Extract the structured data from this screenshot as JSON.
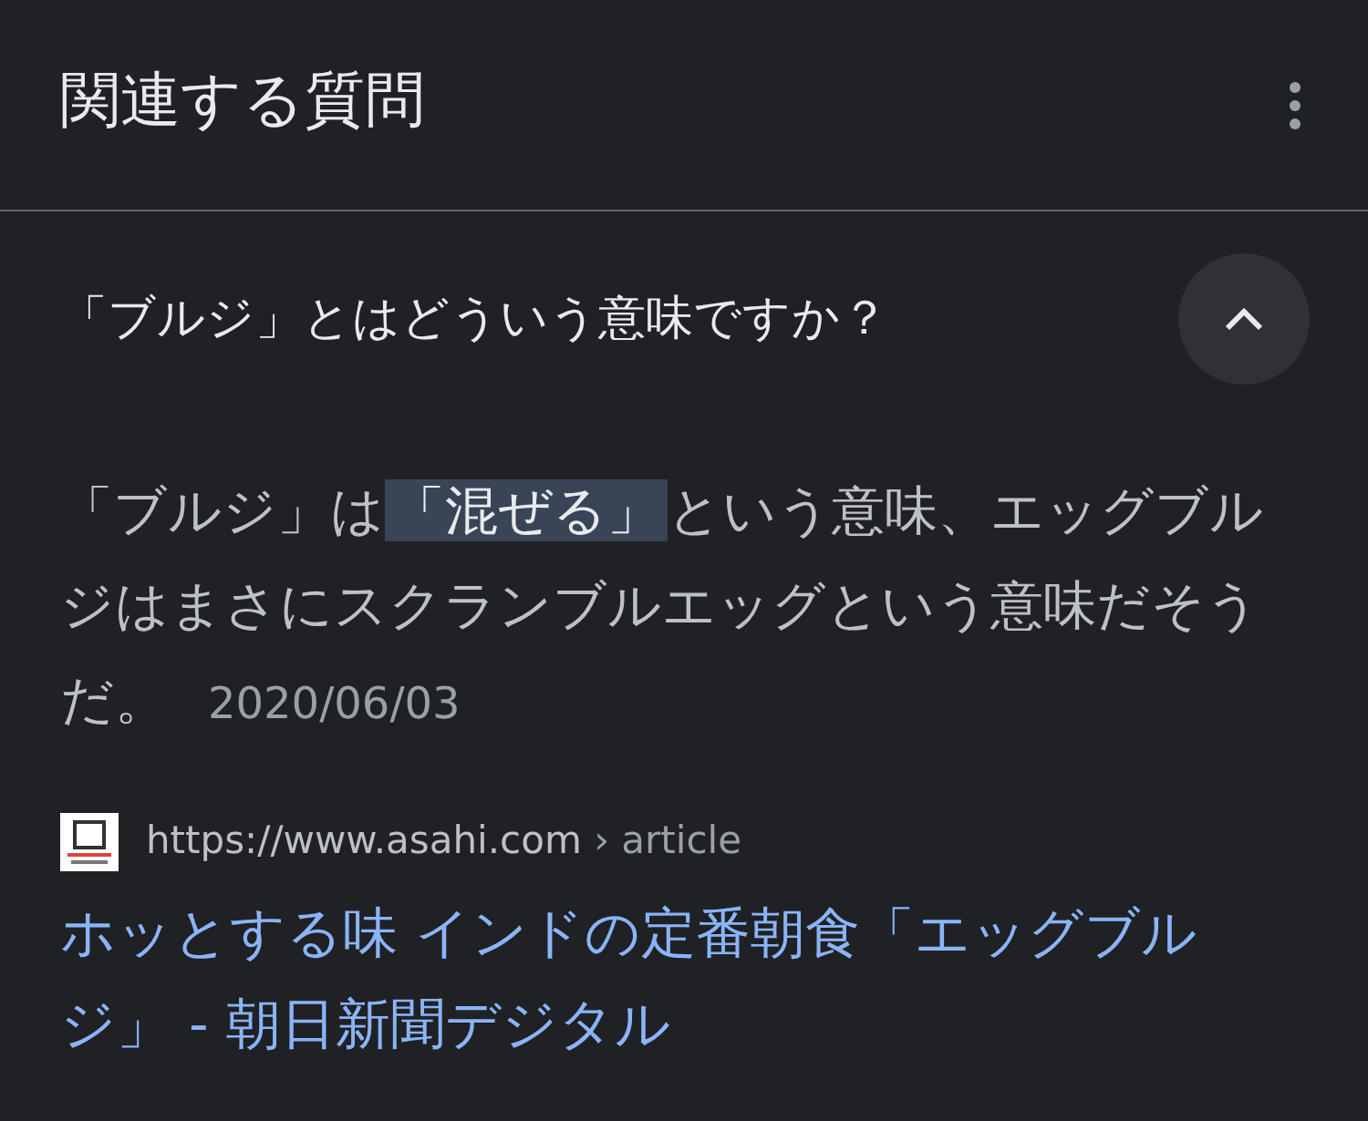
{
  "section": {
    "title": "関連する質問"
  },
  "question": {
    "text": "「ブルジ」とはどういう意味ですか？",
    "expanded": true
  },
  "answer": {
    "before": "「ブルジ」は",
    "highlight": "「混ぜる」",
    "after": "という意味、エッグブルジはまさにスクランブルエッグという意味だそうだ。",
    "date": "2020/06/03"
  },
  "source": {
    "url": "https://www.asahi.com",
    "path": "› article",
    "link": "ホッとする味 インドの定番朝食「エッグブルジ」 - 朝日新聞デジタル"
  }
}
